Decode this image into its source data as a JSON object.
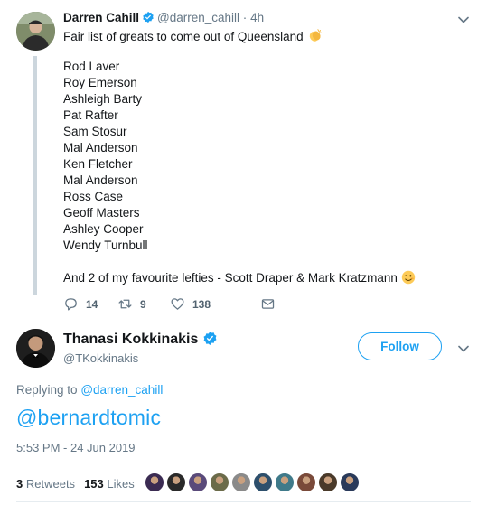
{
  "colors": {
    "accent": "#1da1f2",
    "muted": "#657786",
    "text": "#14171a",
    "line": "#ccd6dd"
  },
  "parent_tweet": {
    "author_name": "Darren Cahill",
    "author_handle": "@darren_cahill",
    "time_ago": "4h",
    "separator": "·",
    "text": "Fair list of greats to come out of Queensland",
    "text_emoji": "clapping-hands-emoji",
    "list": [
      "Rod Laver",
      "Roy Emerson",
      "Ashleigh Barty",
      "Pat Rafter",
      "Sam Stosur",
      "Mal Anderson",
      "Ken Fletcher",
      "Mal Anderson",
      "Ross Case",
      "Geoff Masters",
      "Ashley Cooper",
      "Wendy Turnbull"
    ],
    "closing": "And 2 of my favourite lefties - Scott Draper & Mark Kratzmann",
    "closing_emoji": "winking-face-emoji",
    "actions": {
      "replies": "14",
      "retweets": "9",
      "likes": "138"
    }
  },
  "main_tweet": {
    "author_name": "Thanasi Kokkinakis",
    "author_handle": "@TKokkinakis",
    "follow_label": "Follow",
    "replying_prefix": "Replying to",
    "replying_to": "@darren_cahill",
    "text": "@bernardtomic",
    "timestamp": "5:53 PM - 24 Jun 2019",
    "retweets_count": "3",
    "retweets_label": "Retweets",
    "likes_count": "153",
    "likes_label": "Likes",
    "liker_colors": [
      "#3b2b52",
      "#2a2a2a",
      "#5a4a7a",
      "#6b6b4a",
      "#8a8a8a",
      "#2d4f6c",
      "#3f7a8a",
      "#7a4a3a",
      "#4a3a2a",
      "#2a3a5a"
    ]
  }
}
